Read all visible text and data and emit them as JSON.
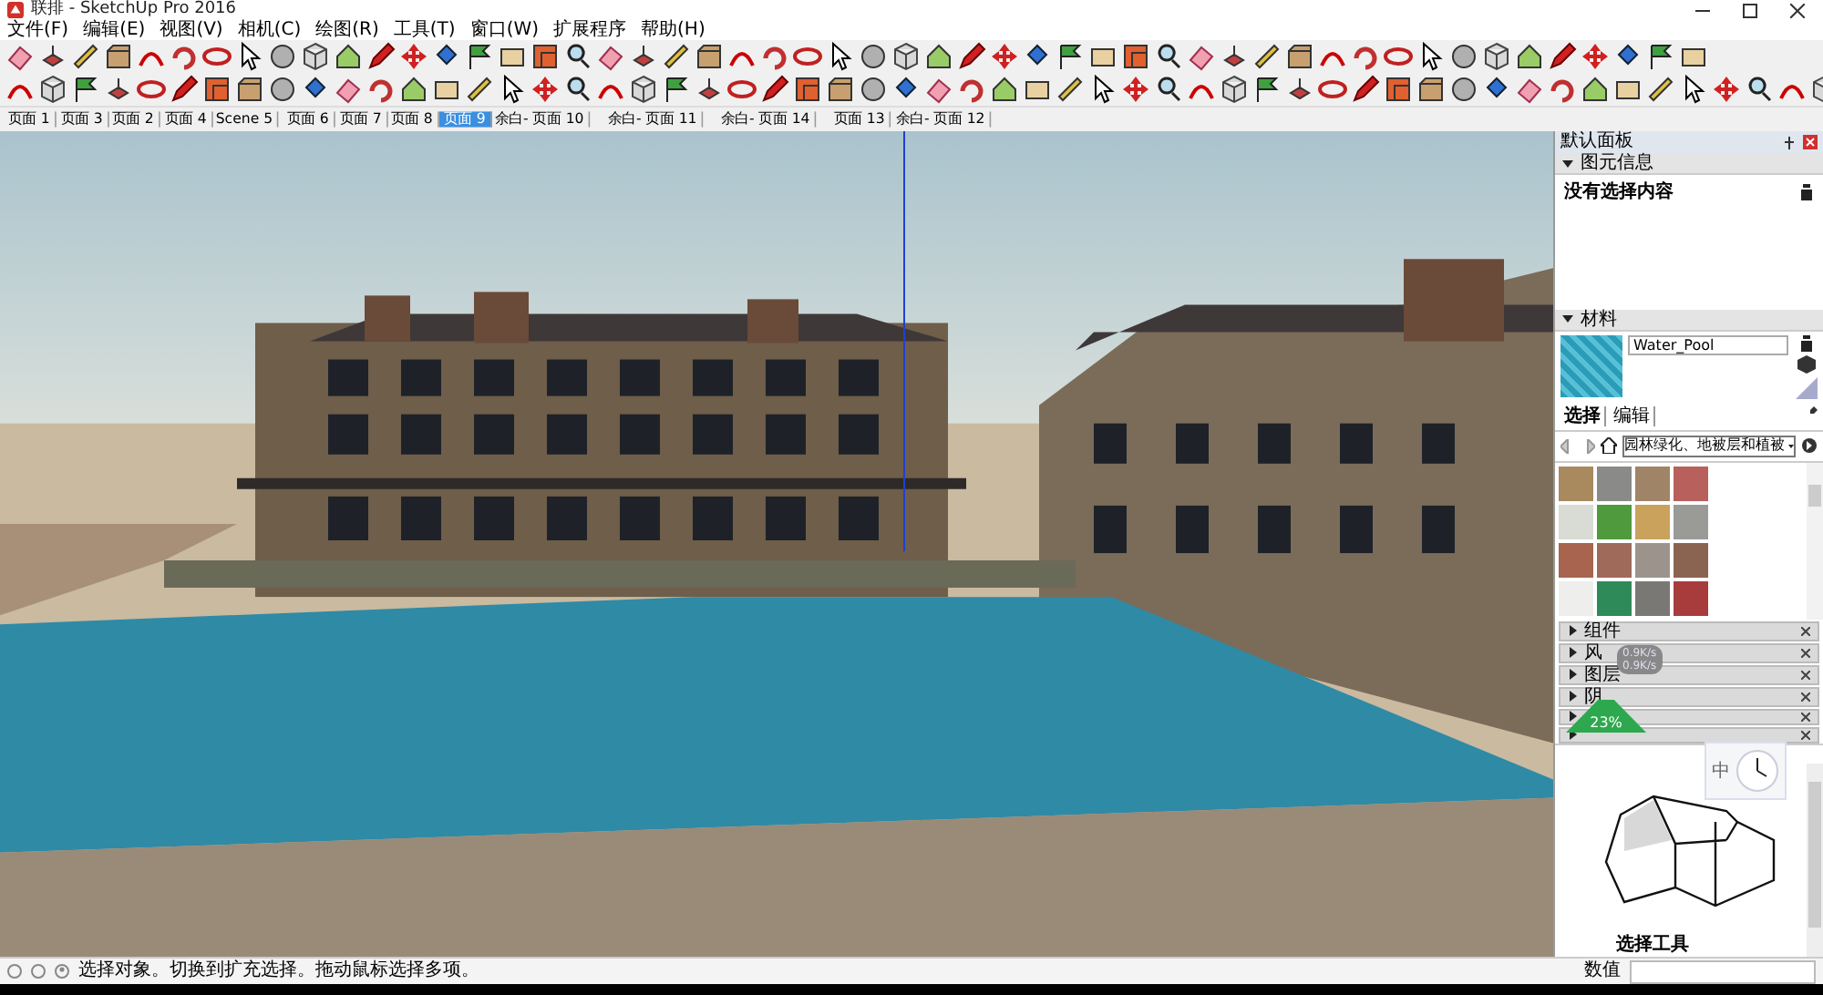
{
  "window": {
    "title": "联排 - SketchUp Pro 2016"
  },
  "menu": [
    "文件(F)",
    "编辑(E)",
    "视图(V)",
    "相机(C)",
    "绘图(R)",
    "工具(T)",
    "窗口(W)",
    "扩展程序",
    "帮助(H)"
  ],
  "page_tabs": [
    {
      "label": "页面 1",
      "selected": false
    },
    {
      "label": "页面 3",
      "selected": false
    },
    {
      "label": "页面 2",
      "selected": false
    },
    {
      "label": "页面 4",
      "selected": false
    },
    {
      "label": "Scene 5",
      "selected": false
    },
    {
      "label": "页面 6",
      "selected": false
    },
    {
      "label": "页面 7",
      "selected": false
    },
    {
      "label": "页面 8",
      "selected": false
    },
    {
      "label": "页面 9",
      "selected": true
    },
    {
      "label": "余白- 页面 10",
      "selected": false
    },
    {
      "label": "余白- 页面 11",
      "selected": false
    },
    {
      "label": "余白- 页面 14",
      "selected": false
    },
    {
      "label": "页面 13",
      "selected": false
    },
    {
      "label": "余白- 页面 12",
      "selected": false
    }
  ],
  "tray": {
    "title": "默认面板",
    "entity_info": {
      "title": "图元信息",
      "expanded": true,
      "message": "没有选择内容"
    },
    "materials": {
      "title": "材料",
      "expanded": true,
      "material_name": "Water_Pool",
      "tabs": [
        {
          "label": "选择",
          "selected": true
        },
        {
          "label": "编辑",
          "selected": false
        }
      ],
      "library": "园林绿化、地被层和植被",
      "swatches": [
        {
          "color": "#a88a5e"
        },
        {
          "color": "#8a8a88"
        },
        {
          "color": "#a08468"
        },
        {
          "color": "#b8605c"
        },
        {
          "color": "#d8dcd4"
        },
        {
          "color": "#4f9a3c"
        },
        {
          "color": "#caa25c"
        },
        {
          "color": "#9a9a96"
        },
        {
          "color": "#a8644e"
        },
        {
          "color": "#a06a5a"
        },
        {
          "color": "#9c948c"
        },
        {
          "color": "#8a6450"
        },
        {
          "color": "#eeeeec"
        },
        {
          "color": "#2f8a5a"
        },
        {
          "color": "#7a7874"
        },
        {
          "color": "#a83c3c"
        }
      ]
    },
    "collapsed_panels": [
      {
        "title": "组件",
        "expanded": false
      },
      {
        "title": "风",
        "expanded": false
      },
      {
        "title": "图层",
        "expanded": false
      },
      {
        "title": "阴",
        "expanded": false
      },
      {
        "expanded": false
      },
      {
        "expanded": false
      }
    ],
    "instructor": {
      "title": "选择工具"
    }
  },
  "overlay": {
    "upload": "0.9K/s",
    "download": "0.9K/s",
    "usage": "23%",
    "ime": "中"
  },
  "status_bar": {
    "message": "选择对象。切换到扩充选择。拖动鼠标选择多项。",
    "measurements_label": "数值"
  }
}
